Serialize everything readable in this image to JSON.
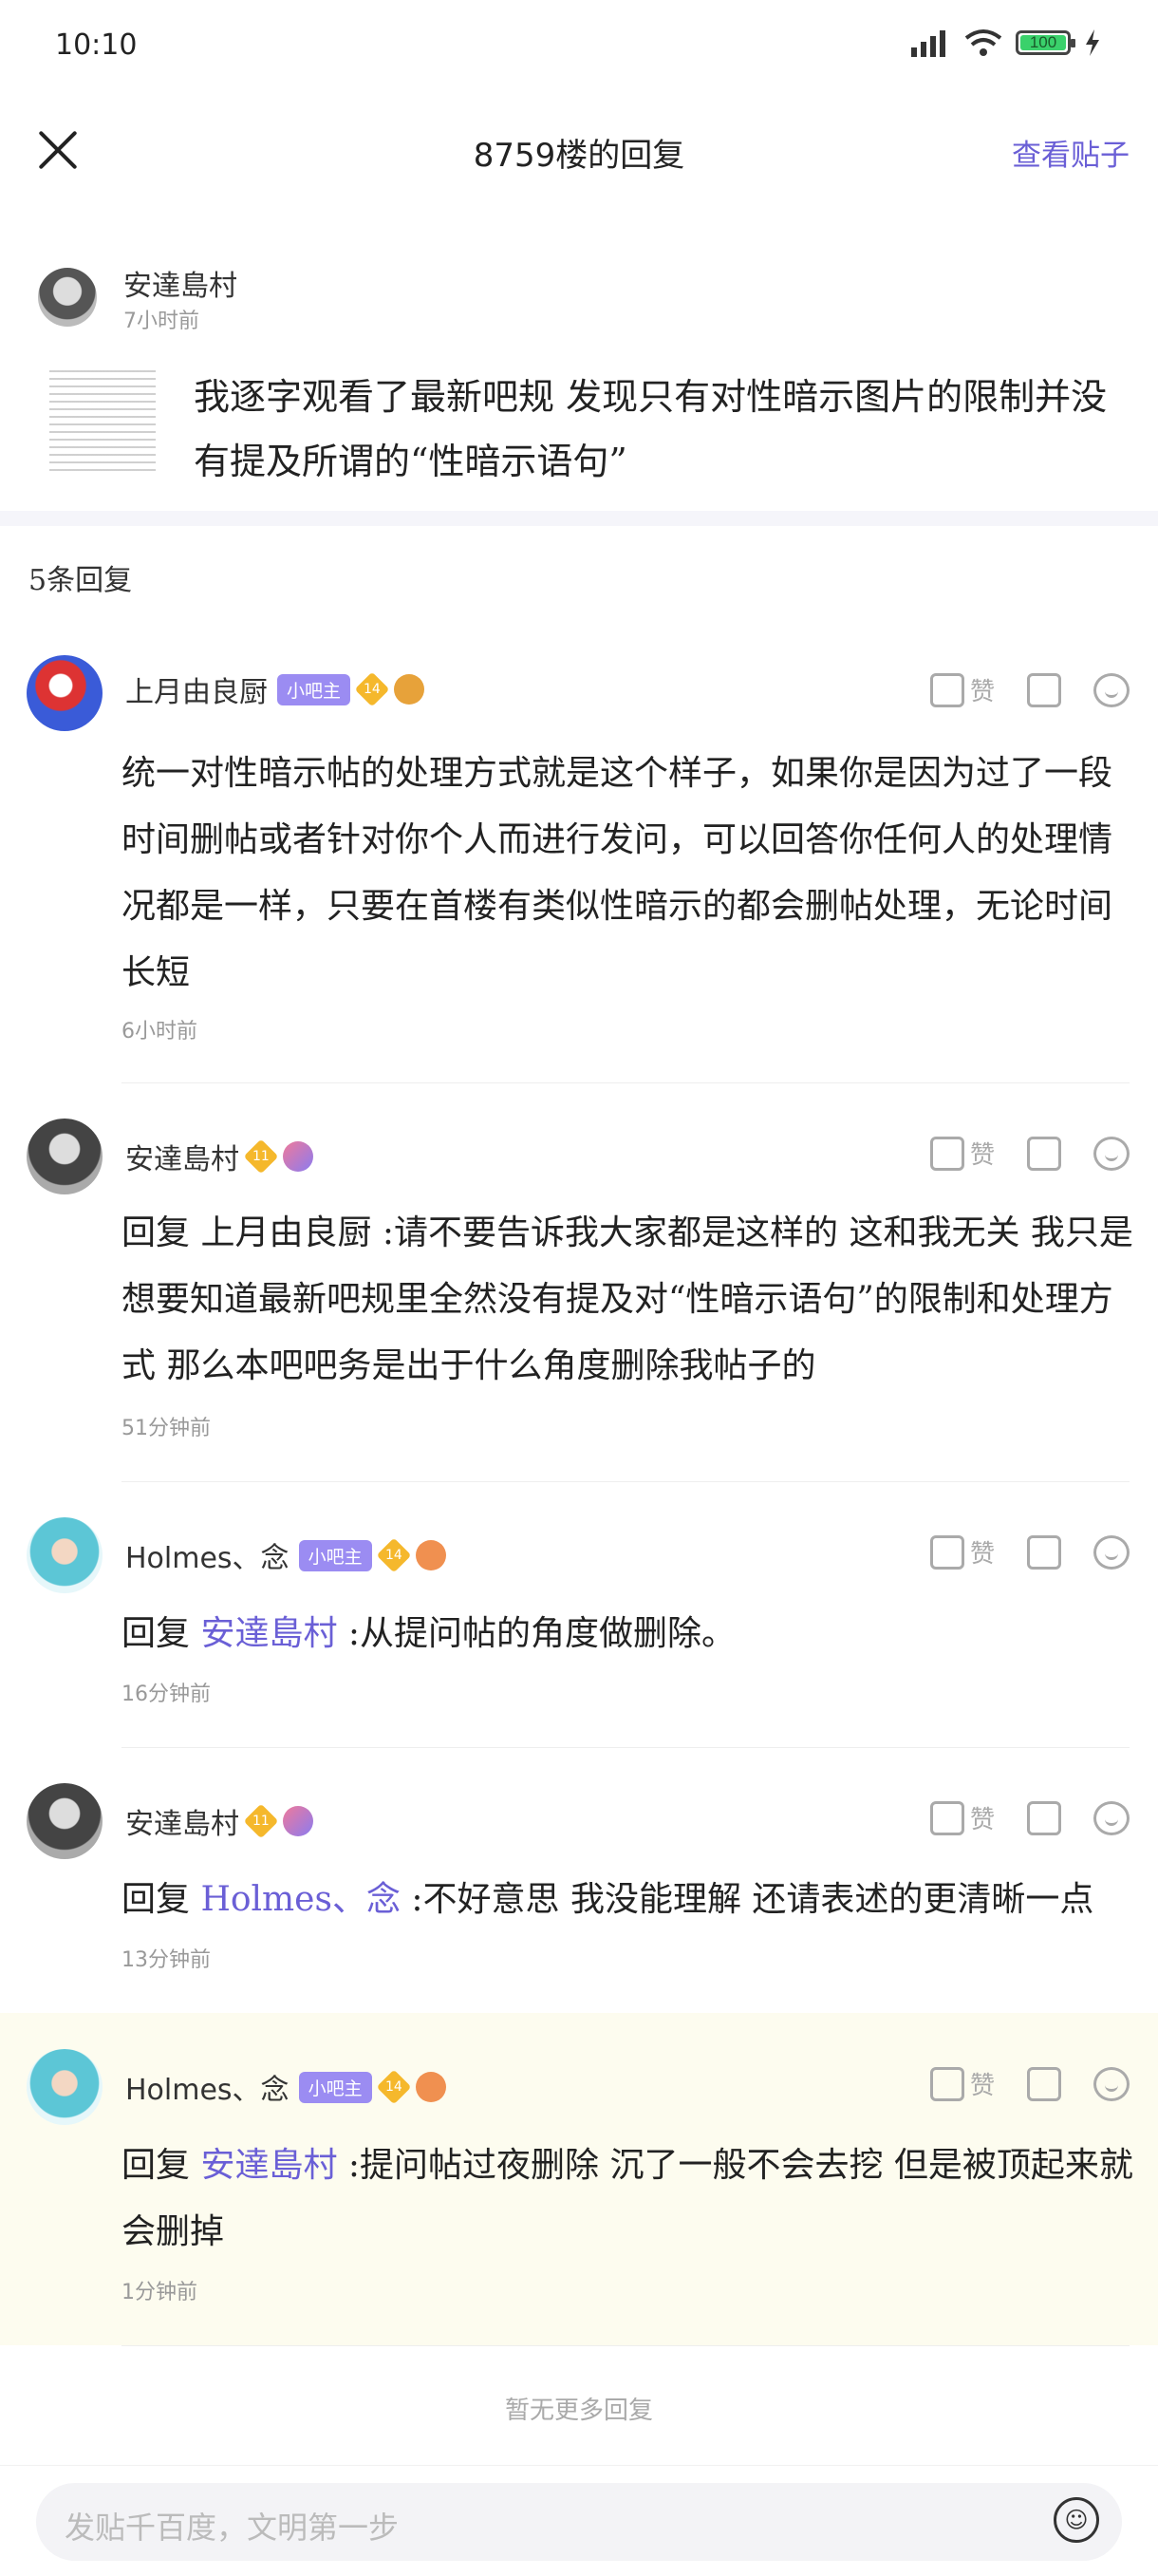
{
  "status": {
    "time": "10:10",
    "battery": "100"
  },
  "header": {
    "title": "8759楼的回复",
    "link": "查看贴子"
  },
  "post": {
    "author": "安達島村",
    "time": "7小时前",
    "text": "我逐字观看了最新吧规 发现只有对性暗示图片的限制并没有提及所谓的“性暗示语句”"
  },
  "reply_count": "5条回复",
  "like_label": "赞",
  "replies": [
    {
      "name": "上月由良厨",
      "admin": "小吧主",
      "level": "14",
      "reply_prefix": "",
      "mention": "",
      "text": "统一对性暗示帖的处理方式就是这个样子，如果你是因为过了一段时间删帖或者针对你个人而进行发问，可以回答你任何人的处理情况都是一样，只要在首楼有类似性暗示的都会删帖处理，无论时间长短",
      "time": "6小时前"
    },
    {
      "name": "安達島村",
      "admin": "",
      "level": "11",
      "reply_prefix": "",
      "mention": "",
      "text": "回复 上月由良厨 :请不要告诉我大家都是这样的 这和我无关 我只是想要知道最新吧规里全然没有提及对“性暗示语句”的限制和处理方式 那么本吧吧务是出于什么角度删除我帖子的",
      "time": "51分钟前"
    },
    {
      "name": "Holmes、念",
      "admin": "小吧主",
      "level": "14",
      "reply_prefix": "回复 ",
      "mention": "安達島村",
      "text": " :从提问帖的角度做删除。",
      "time": "16分钟前"
    },
    {
      "name": "安達島村",
      "admin": "",
      "level": "11",
      "reply_prefix": "回复 ",
      "mention": "Holmes、念",
      "text": " :不好意思 我没能理解 还请表述的更清晰一点",
      "time": "13分钟前"
    },
    {
      "name": "Holmes、念",
      "admin": "小吧主",
      "level": "14",
      "reply_prefix": "回复 ",
      "mention": "安達島村",
      "text": " :提问帖过夜删除 沉了一般不会去挖 但是被顶起来就会删掉",
      "time": "1分钟前"
    }
  ],
  "no_more": "暂无更多回复",
  "input": {
    "placeholder": "发贴千百度，文明第一步"
  },
  "icons": [
    "close-icon",
    "like-icon",
    "dislike-icon",
    "comment-icon",
    "emoji-icon",
    "signal-icon",
    "wifi-icon",
    "battery-icon",
    "charging-icon"
  ]
}
